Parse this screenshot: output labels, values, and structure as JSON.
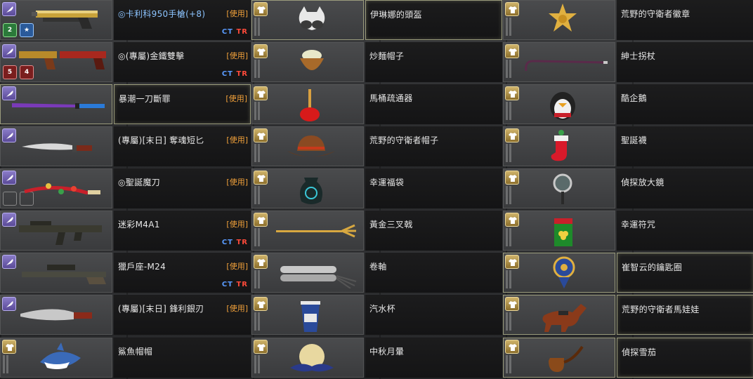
{
  "use_label": "[使用]",
  "team": {
    "ct": "CT",
    "tr": "TR"
  },
  "columns": [
    {
      "items": [
        {
          "name": "◎卡利科950手槍(+8)",
          "name_color": "blue",
          "use": true,
          "team": true,
          "icon": "pistol-gold-icon",
          "badge": "knife-badge-icon",
          "mods": [
            "2",
            "★"
          ]
        },
        {
          "name": "◎(專屬)金鐵雙擊",
          "use": true,
          "team": true,
          "icon": "dual-pistols-icon",
          "badge": "knife-badge-icon",
          "mods": [
            "5",
            "4"
          ]
        },
        {
          "name": "暴潮一刀斷罪",
          "use": true,
          "team": false,
          "icon": "katana-icon",
          "badge": "knife-badge-icon",
          "highlight": true
        },
        {
          "name": "(專屬)[末日] 奪魂短匕",
          "use": true,
          "team": false,
          "icon": "dagger-icon",
          "badge": "knife-badge-icon"
        },
        {
          "name": "◎聖誕魔刀",
          "use": true,
          "team": false,
          "icon": "christmas-blade-icon",
          "badge": "knife-badge-icon",
          "empty_mods": true
        },
        {
          "name": "迷彩M4A1",
          "use": true,
          "team": true,
          "icon": "rifle-m4a1-icon",
          "badge": "knife-badge-icon"
        },
        {
          "name": "獵戶座-M24",
          "use": true,
          "team": true,
          "icon": "sniper-m24-icon",
          "badge": "knife-badge-icon"
        },
        {
          "name": "(專屬)[末日] 鋒利銀刃",
          "use": true,
          "team": false,
          "icon": "machete-icon",
          "badge": "knife-badge-icon"
        },
        {
          "name": "鯊魚帽帽",
          "use": false,
          "team": false,
          "icon": "shark-hat-icon",
          "badge": "shirt-badge-icon"
        }
      ]
    },
    {
      "items": [
        {
          "name": "伊琳娜的頭盔",
          "icon": "goggles-helmet-icon",
          "highlight": true
        },
        {
          "name": "炒麵帽子",
          "icon": "noodle-hat-icon"
        },
        {
          "name": "馬桶疏通器",
          "icon": "plunger-icon"
        },
        {
          "name": "荒野的守衛者帽子",
          "icon": "cowboy-hat-icon"
        },
        {
          "name": "幸運福袋",
          "icon": "lucky-bag-icon"
        },
        {
          "name": "黃金三叉戟",
          "icon": "golden-trident-icon"
        },
        {
          "name": "卷軸",
          "icon": "scroll-icon"
        },
        {
          "name": "汽水杯",
          "icon": "soda-cup-icon"
        },
        {
          "name": "中秋月暈",
          "icon": "moon-halo-icon"
        }
      ]
    },
    {
      "items": [
        {
          "name": "荒野的守衛者徽章",
          "icon": "sheriff-badge-icon"
        },
        {
          "name": "紳士拐杖",
          "icon": "cane-icon"
        },
        {
          "name": "酷企鵝",
          "icon": "penguin-icon"
        },
        {
          "name": "聖誕襪",
          "icon": "christmas-stocking-icon"
        },
        {
          "name": "偵探放大鏡",
          "icon": "magnifier-icon"
        },
        {
          "name": "幸運符咒",
          "icon": "lucky-charm-icon"
        },
        {
          "name": "崔智云的鑰匙圈",
          "icon": "keychain-icon",
          "highlight": true
        },
        {
          "name": "荒野的守衛者馬娃娃",
          "icon": "horse-doll-icon",
          "highlight": true
        },
        {
          "name": "偵探雪茄",
          "icon": "pipe-icon",
          "highlight": true
        }
      ]
    }
  ]
}
